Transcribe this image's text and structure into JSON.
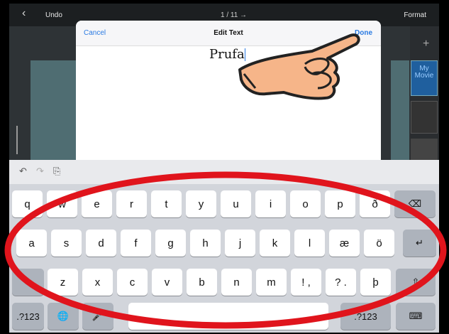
{
  "topbar": {
    "back_icon": "‹",
    "undo": "Undo",
    "page": "1 / 11  →",
    "format": "Format"
  },
  "thumbs": {
    "plus": "+",
    "thumb1_text": "My Movie"
  },
  "modal": {
    "cancel": "Cancel",
    "title": "Edit Text",
    "done": "Done",
    "text_value": "Prufa"
  },
  "toolbar": {
    "undo_icon": "↶",
    "redo_icon": "↷",
    "paste_icon": "⎘"
  },
  "keys": {
    "row1": [
      "q",
      "w",
      "e",
      "r",
      "t",
      "y",
      "u",
      "i",
      "o",
      "p",
      "ð"
    ],
    "row2": [
      "a",
      "s",
      "d",
      "f",
      "g",
      "h",
      "j",
      "k",
      "l",
      "æ",
      "ö"
    ],
    "row3": [
      "z",
      "x",
      "c",
      "v",
      "b",
      "n",
      "m",
      "! ,",
      "? .",
      "þ"
    ],
    "backspace": "⌫",
    "return": "↵",
    "shift": "⇧",
    "numbers": ".?123",
    "globe": "🌐",
    "mic": "🎤",
    "space": "",
    "numbers_right": ".?123",
    "hide_keyboard": "⌨"
  },
  "colors": {
    "accent": "#2a7ae2",
    "annotation": "#e0141c",
    "hand_skin": "#f6b589"
  }
}
